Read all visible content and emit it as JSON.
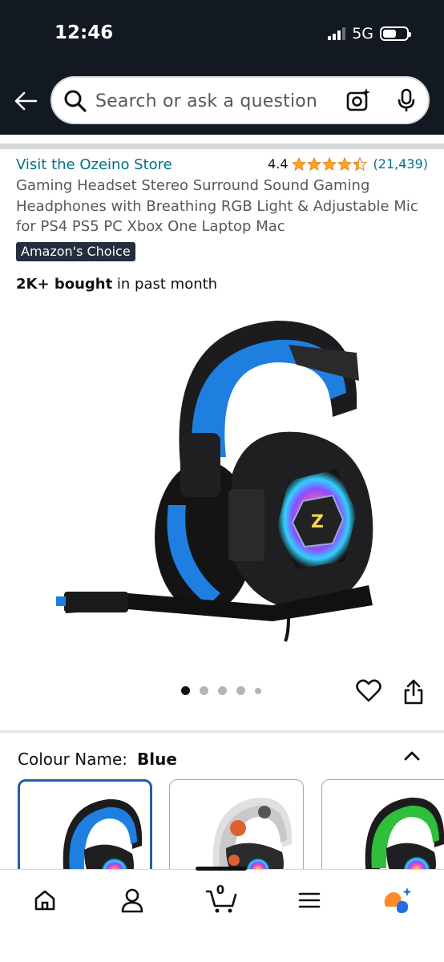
{
  "status_bar": {
    "time": "12:46",
    "network": "5G"
  },
  "header": {
    "search_placeholder": "Search or ask a question"
  },
  "product": {
    "store_link": "Visit the Ozeino Store",
    "rating_value": "4.4",
    "rating_stars": 4.4,
    "rating_count": "(21,439)",
    "title": "Gaming Headset Stereo Surround Sound Gaming Headphones with Breathing RGB Light & Adjustable Mic for PS4 PS5 PC Xbox One Laptop Mac",
    "badge": "Amazon's Choice",
    "bought_bold": "2K+ bought",
    "bought_rest": " in past month",
    "image_count": 5,
    "active_image": 1
  },
  "variants": {
    "label": "Colour Name:",
    "selected": "Blue"
  },
  "bottom_nav": {
    "cart_count": "0",
    "items": [
      "home-icon",
      "account-icon",
      "cart-icon",
      "menu-icon",
      "assistant-icon"
    ]
  },
  "colors": {
    "header_bg": "#131921",
    "link": "#007185",
    "star": "#ffa41c",
    "badge_bg": "#232f3e",
    "selected_border": "#2162a1"
  }
}
